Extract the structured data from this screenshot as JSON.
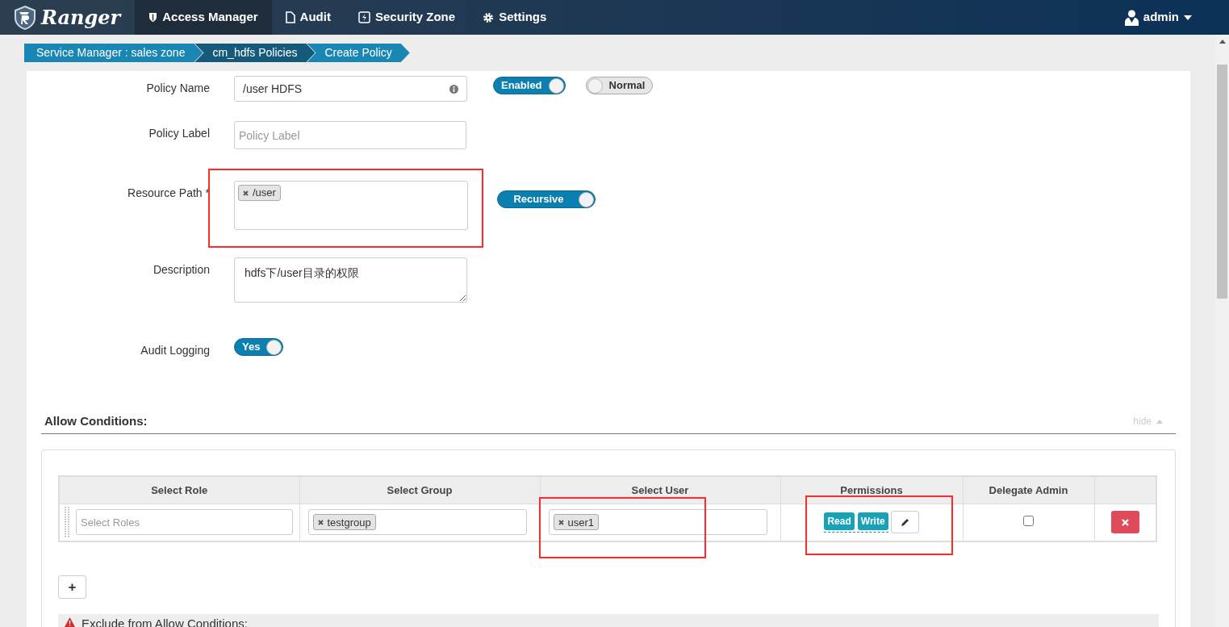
{
  "nav": {
    "brand": "Ranger",
    "items": [
      {
        "label": "Access Manager",
        "selected": true
      },
      {
        "label": "Audit",
        "selected": false
      },
      {
        "label": "Security Zone",
        "selected": false
      },
      {
        "label": "Settings",
        "selected": false
      }
    ],
    "user": "admin"
  },
  "breadcrumb": [
    {
      "label": "Service Manager : sales zone"
    },
    {
      "label": "cm_hdfs Policies"
    },
    {
      "label": "Create Policy"
    }
  ],
  "policy_name": {
    "label": "Policy Name",
    "value": "/user HDFS",
    "toggles": [
      {
        "label": "Enabled",
        "on": true
      },
      {
        "label": "Normal",
        "on": false
      }
    ]
  },
  "policy_label": {
    "label": "Policy Label",
    "placeholder": "Policy Label"
  },
  "resource_path": {
    "label": "Resource Path *",
    "tags": [
      "/user"
    ],
    "toggle": {
      "label": "Recursive",
      "on": true
    }
  },
  "description": {
    "label": "Description",
    "value": "hdfs下/user目录的权限"
  },
  "audit_logging": {
    "label": "Audit Logging",
    "toggle": {
      "label": "Yes",
      "on": true
    }
  },
  "allow_conditions": {
    "title": "Allow Conditions:",
    "hide_link": "hide",
    "columns": [
      "Select Role",
      "Select Group",
      "Select User",
      "Permissions",
      "Delegate Admin"
    ],
    "rows": [
      {
        "role_placeholder": "Select Roles",
        "groups": [
          "testgroup"
        ],
        "users": [
          "user1"
        ],
        "permissions": [
          "Read",
          "Write"
        ],
        "delegate_admin": false
      }
    ],
    "add_button": "+"
  },
  "exclude": {
    "title": "Exclude from Allow Conditions:"
  }
}
